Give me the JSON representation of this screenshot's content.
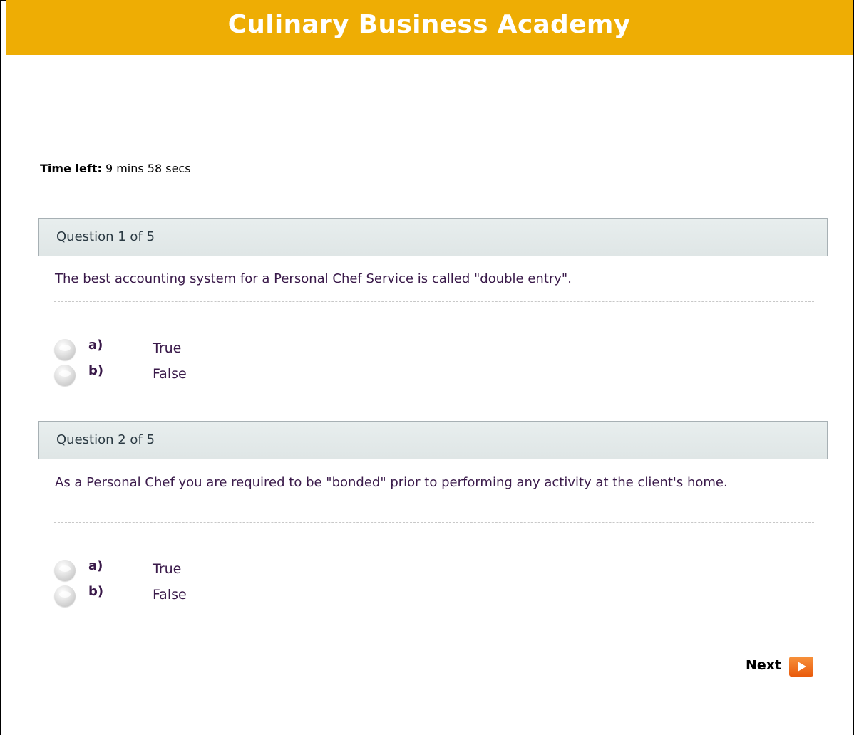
{
  "header": {
    "title": "Culinary Business Academy"
  },
  "timer": {
    "label": "Time left:",
    "value": "9 mins 58 secs"
  },
  "questions": [
    {
      "header": "Question 1 of 5",
      "text": "The best accounting system for a Personal Chef Service is called \"double entry\".",
      "options": [
        {
          "letter": "a)",
          "label": "True"
        },
        {
          "letter": "b)",
          "label": "False"
        }
      ]
    },
    {
      "header": "Question 2 of 5",
      "text": "As a Personal Chef you are required to be \"bonded\" prior to performing any activity at the client's home.",
      "options": [
        {
          "letter": "a)",
          "label": "True"
        },
        {
          "letter": "b)",
          "label": "False"
        }
      ]
    }
  ],
  "navigation": {
    "next_label": "Next",
    "next_icon": "arrow-right-icon"
  },
  "colors": {
    "header_bg": "#eead04",
    "accent_text": "#3a1a4a",
    "next_icon": "#e95a0c"
  }
}
